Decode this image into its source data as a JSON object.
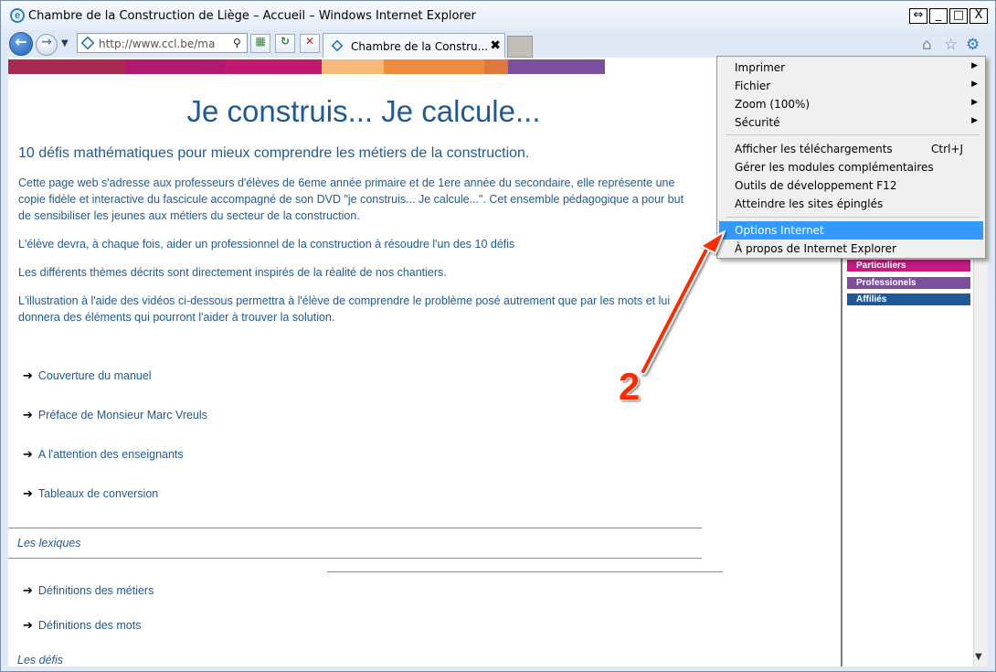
{
  "window": {
    "title": "Chambre de la Construction de Liège – Accueil – Windows Internet Explorer",
    "controls": [
      "⇔",
      "_",
      "□",
      "X"
    ]
  },
  "nav": {
    "back_glyph": "←",
    "forward_glyph": "→",
    "dropdown_glyph": "▼",
    "address": "http://www.ccl.be/ma",
    "search_glyph": "⚲",
    "toolbar_buttons": [
      "▦",
      "↻",
      "✕"
    ]
  },
  "tab": {
    "label": "Chambre de la Constru...",
    "close": "✖"
  },
  "right_icons": {
    "home": "⌂",
    "favorites": "☆",
    "tools": "⚙"
  },
  "colors": {
    "stripes": [
      "#a82a50",
      "#b0196f",
      "#c0196f",
      "#f8b87a",
      "#ec8c3c",
      "#e8843c",
      "#7b4fa0"
    ],
    "link_color": "#1f5a96",
    "sidebar_particuliers": "#c41a82",
    "sidebar_professionnels": "#7c4f9c",
    "sidebar_affilies": "#1f5a96",
    "menu_highlight": "#3399ff",
    "annotation": "#ff2a00"
  },
  "page": {
    "title": "Je construis... Je calcule...",
    "subtitle": "10 défis mathématiques pour mieux comprendre les métiers de la construction.",
    "paragraphs": [
      "Cette page web s'adresse aux professeurs d'élèves de 6eme année primaire et de 1ere année du secondaire, elle représente une copie fidèle et interactive du fascicule accompagné de son DVD \"je construis... Je calcule...\". Cet ensemble pédagogique a pour but de sensibiliser les jeunes aux métiers du secteur de la construction.",
      "L'élève devra, à chaque fois, aider un professionnel de la construction à résoudre l'un des 10 défis",
      "Les différents thèmes décrits sont directement inspirés de la réalité de nos chantiers.",
      "L'illustration à l'aide des vidéos ci-dessous permettra à l'élève de comprendre le problème posé autrement que par les mots et lui donnera des éléments qui pourront l'aider à trouver la solution."
    ],
    "links": [
      "Couverture du manuel",
      "Préface de Monsieur Marc Vreuls",
      "A l'attention des enseignants",
      "Tableaux de conversion"
    ],
    "arrow_glyph": "➔",
    "section_lexiques": "Les lexiques",
    "lexique_links": [
      "Définitions des métiers",
      "Définitions des mots"
    ],
    "section_defis": "Les défis"
  },
  "sidebar": {
    "particuliers": "Particuliers",
    "professionnels": "Professionels",
    "affilies": "Affiliés"
  },
  "menu": {
    "items": [
      {
        "label": "Imprimer",
        "submenu": "▶"
      },
      {
        "label": "Fichier",
        "submenu": "▶"
      },
      {
        "label": "Zoom (100%)",
        "submenu": "▶"
      },
      {
        "label": "Sécurité",
        "submenu": "▶"
      },
      {
        "label": "Afficher les téléchargements",
        "shortcut": "Ctrl+J"
      },
      {
        "label": "Gérer les modules complémentaires"
      },
      {
        "label": "Outils de développement F12"
      },
      {
        "label": "Atteindre les sites épinglés"
      },
      {
        "label": "Options Internet"
      },
      {
        "label": "À propos de Internet Explorer"
      }
    ],
    "highlighted_item": "Options Internet"
  },
  "annotation": {
    "number": "2"
  },
  "scroll": {
    "down": "▼"
  }
}
